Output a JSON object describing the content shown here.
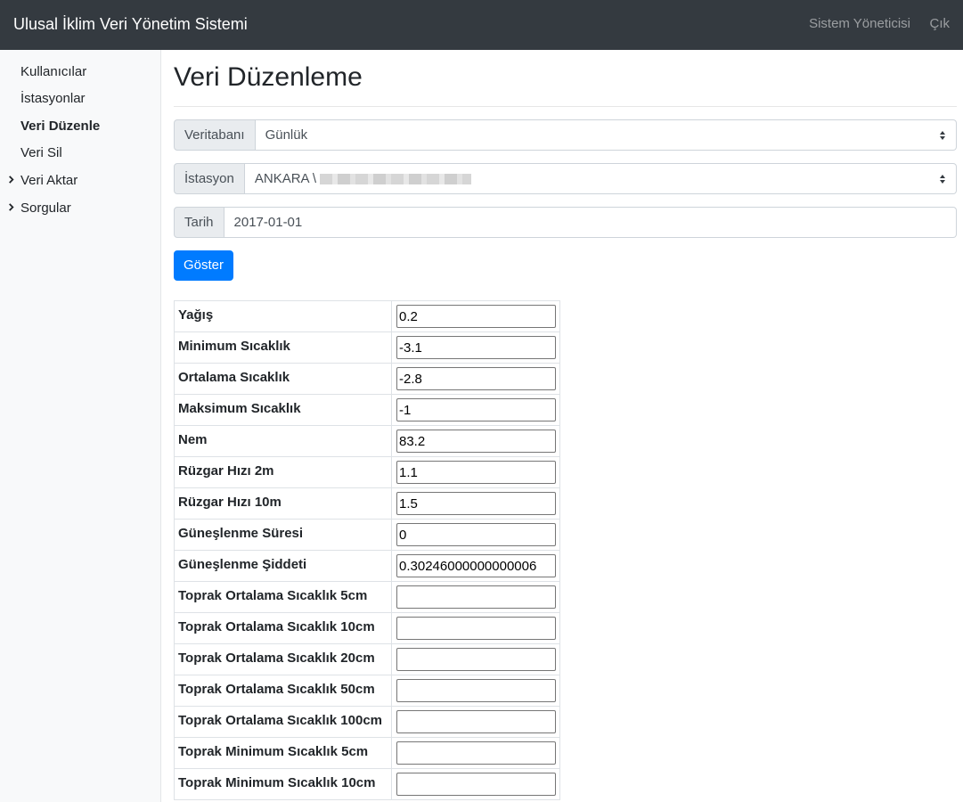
{
  "header": {
    "brand": "Ulusal İklim Veri Yönetim Sistemi",
    "user": "Sistem Yöneticisi",
    "logout": "Çık"
  },
  "sidebar": {
    "items": [
      {
        "label": "Kullanıcılar"
      },
      {
        "label": "İstasyonlar"
      },
      {
        "label": "Veri Düzenle"
      },
      {
        "label": "Veri Sil"
      },
      {
        "label": "Veri Aktar"
      },
      {
        "label": "Sorgular"
      }
    ]
  },
  "main": {
    "title": "Veri Düzenleme",
    "database": {
      "label": "Veritabanı",
      "value": "Günlük"
    },
    "station": {
      "label": "İstasyon",
      "value": "ANKARA \\"
    },
    "date": {
      "label": "Tarih",
      "value": "2017-01-01"
    },
    "show_button": "Göster"
  },
  "table": {
    "rows": [
      {
        "label": "Yağış",
        "value": "0.2"
      },
      {
        "label": "Minimum Sıcaklık",
        "value": "-3.1"
      },
      {
        "label": "Ortalama Sıcaklık",
        "value": "-2.8"
      },
      {
        "label": "Maksimum Sıcaklık",
        "value": "-1"
      },
      {
        "label": "Nem",
        "value": "83.2"
      },
      {
        "label": "Rüzgar Hızı 2m",
        "value": "1.1"
      },
      {
        "label": "Rüzgar Hızı 10m",
        "value": "1.5"
      },
      {
        "label": "Güneşlenme Süresi",
        "value": "0"
      },
      {
        "label": "Güneşlenme Şiddeti",
        "value": "0.30246000000000006"
      },
      {
        "label": "Toprak Ortalama Sıcaklık 5cm",
        "value": ""
      },
      {
        "label": "Toprak Ortalama Sıcaklık 10cm",
        "value": ""
      },
      {
        "label": "Toprak Ortalama Sıcaklık 20cm",
        "value": ""
      },
      {
        "label": "Toprak Ortalama Sıcaklık 50cm",
        "value": ""
      },
      {
        "label": "Toprak Ortalama Sıcaklık 100cm",
        "value": ""
      },
      {
        "label": "Toprak Minimum Sıcaklık 5cm",
        "value": ""
      },
      {
        "label": "Toprak Minimum Sıcaklık 10cm",
        "value": ""
      }
    ]
  },
  "colors": {
    "navbar": "#343a40",
    "sidebar": "#f8f9fa",
    "primary": "#007bff"
  }
}
